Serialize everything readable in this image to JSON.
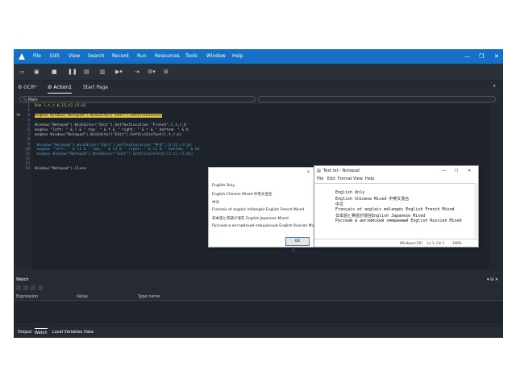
{
  "menubar": {
    "items": [
      "File",
      "Edit",
      "View",
      "Search",
      "Record",
      "Run",
      "Resources",
      "Tools",
      "Window",
      "Help"
    ]
  },
  "tabs": [
    {
      "label": "OCR*"
    },
    {
      "label": "Action1"
    },
    {
      "label": "Start Page"
    }
  ],
  "scope": {
    "left": "Main",
    "right": ""
  },
  "editor": {
    "line_numbers": [
      "1",
      "2",
      "3",
      "4",
      "5",
      "6",
      "7",
      "8",
      "9",
      "10",
      "11",
      "12",
      "13",
      "14"
    ],
    "lines": [
      "Dim l,t,r,b,l2,t2,r2,b2",
      "",
      "msgbox Window(\"Notepad\").WinEditor(\"Edit\").GetVisibleText",
      "",
      "Window(\"Notepad\").WinEditor(\"Edit\").GetTextLocation \"French\",l,t,r,b",
      "msgbox \"left: \" & l & \" top: \" & t & \" right: \" & r & \" bottom: \" & b",
      "msgbox Window(\"Notepad\").WinEditor(\"Edit\").GetVisibleText(l,t,r,b)",
      "",
      "'Window(\"Notepad\").WinEditor(\"Edit\").GetTextLocation \"中文\",l2,t2,r2,b2",
      "'msgbox \"left: \" & l2 & \" top: \" & t2 & \" right: \" & r2 & \" bottom: \" & b2",
      "'msgbox Window(\"Notepad\").WinEditor(\"Edit\").GetVisibleText(l2,t2,r2,b2)",
      "",
      "",
      "Window(\"Notepad\").Close"
    ]
  },
  "watch": {
    "title": "Watch",
    "columns": [
      "Expression",
      "Value",
      "Type name"
    ]
  },
  "bottom_tabs": [
    "Output",
    "Watch",
    "Local Variables",
    "Data"
  ],
  "msgbox": {
    "lines": [
      "English Only",
      "English Chinese Mixed 中英文混合",
      "中文",
      "Francais et anglais mélangés English French Mixed",
      "日本語と英語が混在 English Japanese Mixed",
      "Русский и английский смешанный English Russian Mixed"
    ],
    "ok": "OK"
  },
  "notepad": {
    "title": "Text.txt - Notepad",
    "menu": [
      "File",
      "Edit",
      "Format",
      "View",
      "Help"
    ],
    "lines": [
      "English Only",
      "English Chinese Mixed 中英文混合",
      "中文",
      "Français et anglais mélangés English French Mixed",
      "日本語と英語が混在English Japanese Mixed",
      "Русский и английский смешанный English Russian Mixed"
    ],
    "status_eol": "Windows (CR)",
    "status_pos": "Ln 1, Col 1",
    "status_zoom": "100%"
  },
  "colors": {
    "accent": "#1570c8",
    "background": "#252a33",
    "editor": "#1e222a"
  }
}
